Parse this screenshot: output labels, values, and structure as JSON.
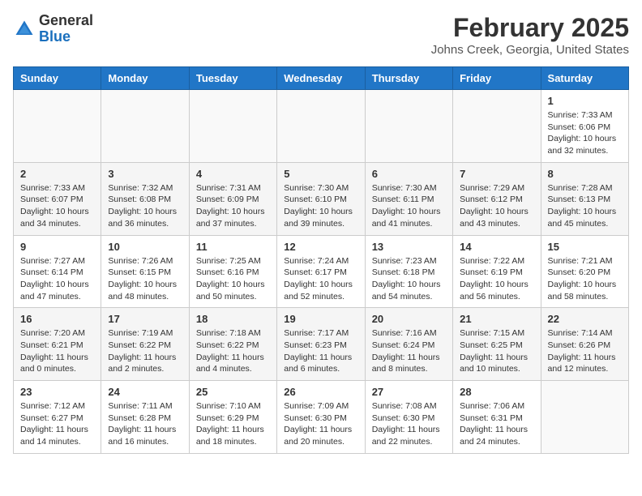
{
  "header": {
    "logo_line1": "General",
    "logo_line2": "Blue",
    "month_title": "February 2025",
    "location": "Johns Creek, Georgia, United States"
  },
  "days_of_week": [
    "Sunday",
    "Monday",
    "Tuesday",
    "Wednesday",
    "Thursday",
    "Friday",
    "Saturday"
  ],
  "weeks": [
    [
      {
        "day": "",
        "info": ""
      },
      {
        "day": "",
        "info": ""
      },
      {
        "day": "",
        "info": ""
      },
      {
        "day": "",
        "info": ""
      },
      {
        "day": "",
        "info": ""
      },
      {
        "day": "",
        "info": ""
      },
      {
        "day": "1",
        "info": "Sunrise: 7:33 AM\nSunset: 6:06 PM\nDaylight: 10 hours and 32 minutes."
      }
    ],
    [
      {
        "day": "2",
        "info": "Sunrise: 7:33 AM\nSunset: 6:07 PM\nDaylight: 10 hours and 34 minutes."
      },
      {
        "day": "3",
        "info": "Sunrise: 7:32 AM\nSunset: 6:08 PM\nDaylight: 10 hours and 36 minutes."
      },
      {
        "day": "4",
        "info": "Sunrise: 7:31 AM\nSunset: 6:09 PM\nDaylight: 10 hours and 37 minutes."
      },
      {
        "day": "5",
        "info": "Sunrise: 7:30 AM\nSunset: 6:10 PM\nDaylight: 10 hours and 39 minutes."
      },
      {
        "day": "6",
        "info": "Sunrise: 7:30 AM\nSunset: 6:11 PM\nDaylight: 10 hours and 41 minutes."
      },
      {
        "day": "7",
        "info": "Sunrise: 7:29 AM\nSunset: 6:12 PM\nDaylight: 10 hours and 43 minutes."
      },
      {
        "day": "8",
        "info": "Sunrise: 7:28 AM\nSunset: 6:13 PM\nDaylight: 10 hours and 45 minutes."
      }
    ],
    [
      {
        "day": "9",
        "info": "Sunrise: 7:27 AM\nSunset: 6:14 PM\nDaylight: 10 hours and 47 minutes."
      },
      {
        "day": "10",
        "info": "Sunrise: 7:26 AM\nSunset: 6:15 PM\nDaylight: 10 hours and 48 minutes."
      },
      {
        "day": "11",
        "info": "Sunrise: 7:25 AM\nSunset: 6:16 PM\nDaylight: 10 hours and 50 minutes."
      },
      {
        "day": "12",
        "info": "Sunrise: 7:24 AM\nSunset: 6:17 PM\nDaylight: 10 hours and 52 minutes."
      },
      {
        "day": "13",
        "info": "Sunrise: 7:23 AM\nSunset: 6:18 PM\nDaylight: 10 hours and 54 minutes."
      },
      {
        "day": "14",
        "info": "Sunrise: 7:22 AM\nSunset: 6:19 PM\nDaylight: 10 hours and 56 minutes."
      },
      {
        "day": "15",
        "info": "Sunrise: 7:21 AM\nSunset: 6:20 PM\nDaylight: 10 hours and 58 minutes."
      }
    ],
    [
      {
        "day": "16",
        "info": "Sunrise: 7:20 AM\nSunset: 6:21 PM\nDaylight: 11 hours and 0 minutes."
      },
      {
        "day": "17",
        "info": "Sunrise: 7:19 AM\nSunset: 6:22 PM\nDaylight: 11 hours and 2 minutes."
      },
      {
        "day": "18",
        "info": "Sunrise: 7:18 AM\nSunset: 6:22 PM\nDaylight: 11 hours and 4 minutes."
      },
      {
        "day": "19",
        "info": "Sunrise: 7:17 AM\nSunset: 6:23 PM\nDaylight: 11 hours and 6 minutes."
      },
      {
        "day": "20",
        "info": "Sunrise: 7:16 AM\nSunset: 6:24 PM\nDaylight: 11 hours and 8 minutes."
      },
      {
        "day": "21",
        "info": "Sunrise: 7:15 AM\nSunset: 6:25 PM\nDaylight: 11 hours and 10 minutes."
      },
      {
        "day": "22",
        "info": "Sunrise: 7:14 AM\nSunset: 6:26 PM\nDaylight: 11 hours and 12 minutes."
      }
    ],
    [
      {
        "day": "23",
        "info": "Sunrise: 7:12 AM\nSunset: 6:27 PM\nDaylight: 11 hours and 14 minutes."
      },
      {
        "day": "24",
        "info": "Sunrise: 7:11 AM\nSunset: 6:28 PM\nDaylight: 11 hours and 16 minutes."
      },
      {
        "day": "25",
        "info": "Sunrise: 7:10 AM\nSunset: 6:29 PM\nDaylight: 11 hours and 18 minutes."
      },
      {
        "day": "26",
        "info": "Sunrise: 7:09 AM\nSunset: 6:30 PM\nDaylight: 11 hours and 20 minutes."
      },
      {
        "day": "27",
        "info": "Sunrise: 7:08 AM\nSunset: 6:30 PM\nDaylight: 11 hours and 22 minutes."
      },
      {
        "day": "28",
        "info": "Sunrise: 7:06 AM\nSunset: 6:31 PM\nDaylight: 11 hours and 24 minutes."
      },
      {
        "day": "",
        "info": ""
      }
    ]
  ]
}
